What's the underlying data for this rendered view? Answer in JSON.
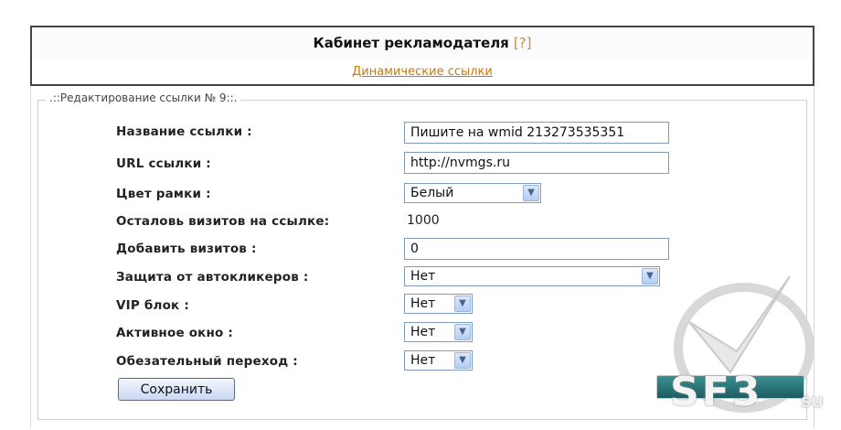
{
  "header": {
    "title": "Кабинет рекламодателя",
    "help": "[?]"
  },
  "nav": {
    "link": "Динамические ссылки"
  },
  "form": {
    "legend": ".::Редактирование ссылки № 9::.",
    "link_name_label": "Название ссылки :",
    "link_name_value": "Пишите на wmid 213273535351",
    "url_label": "URL ссылки :",
    "url_value": "http://nvmgs.ru",
    "frame_color_label": "Цвет рамки :",
    "frame_color_value": "Белый",
    "visits_left_label": "Осталовь визитов на ссылке:",
    "visits_left_value": "1000",
    "add_visits_label": "Добавить визитов :",
    "add_visits_value": "0",
    "autoclick_label": "Защита от автокликеров :",
    "autoclick_value": "Нет",
    "vip_label": "VIP блок :",
    "vip_value": "Нет",
    "active_window_label": "Активное окно :",
    "active_window_value": "Нет",
    "mandatory_label": "Обезательный переход :",
    "mandatory_value": "Нет",
    "save_button": "Сохранить"
  },
  "watermark": {
    "text": "SF3",
    "suffix": "SU"
  }
}
